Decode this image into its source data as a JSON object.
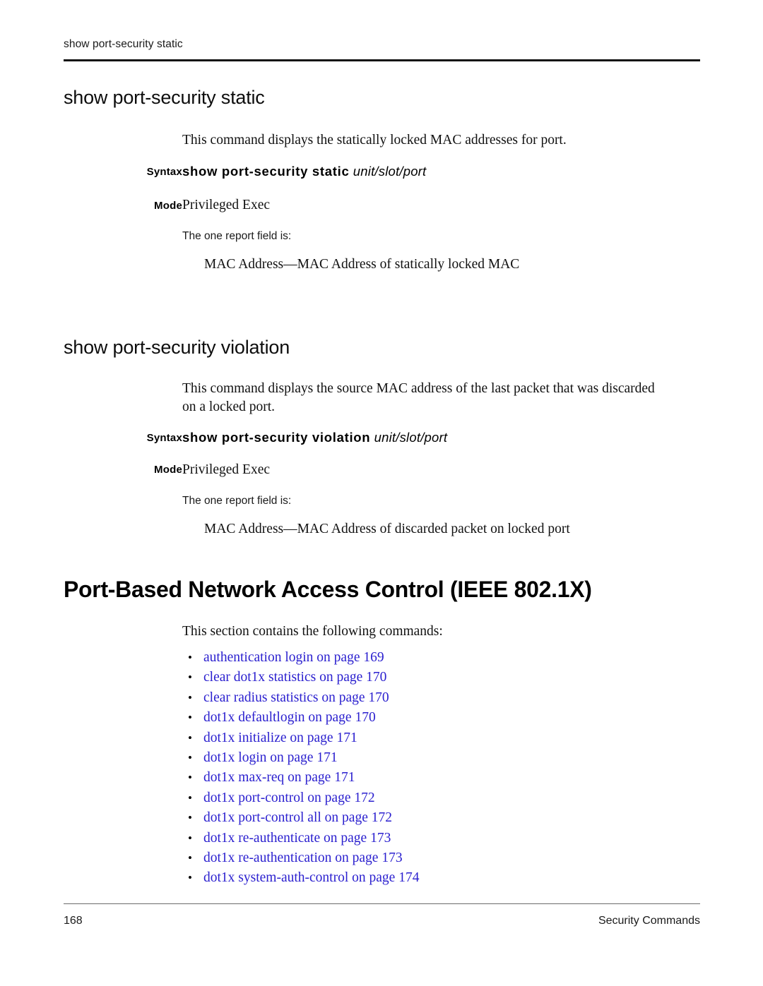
{
  "running_header": "show port-security static",
  "sections": [
    {
      "heading": "show port-security static",
      "description": "This command displays the statically locked MAC addresses for port.",
      "syntax_label": "Syntax",
      "syntax_command": "show port-security static",
      "syntax_argument": "unit/slot/port",
      "mode_label": "Mode",
      "mode_value": "Privileged Exec",
      "report_note": "The one report field is:",
      "report_field": "MAC Address—MAC Address of statically locked MAC"
    },
    {
      "heading": "show port-security violation",
      "description": "This command displays the source MAC address of the last packet that was discarded on a locked port.",
      "syntax_label": "Syntax",
      "syntax_command": "show port-security violation",
      "syntax_argument": "unit/slot/port",
      "mode_label": "Mode",
      "mode_value": "Privileged Exec",
      "report_note": "The one report field is:",
      "report_field": "MAC Address—MAC Address of discarded packet on locked port"
    }
  ],
  "major_section": {
    "heading": "Port-Based Network Access Control (IEEE 802.1X)",
    "intro": "This section contains the following commands:",
    "bullet": "•",
    "links": [
      "authentication login on page 169",
      "clear dot1x statistics on page 170",
      "clear radius statistics on page 170",
      "dot1x defaultlogin on page 170",
      "dot1x initialize on page 171",
      "dot1x login on page 171",
      "dot1x max-req on page 171",
      "dot1x port-control on page 172",
      "dot1x port-control all on page 172",
      "dot1x re-authenticate on page 173",
      "dot1x re-authentication on page 173",
      "dot1x system-auth-control on page 174"
    ]
  },
  "footer": {
    "page_number": "168",
    "title": "Security Commands"
  },
  "colors": {
    "link": "#2b20cf",
    "text": "#111111",
    "rule_dark": "#111111",
    "rule_light": "#6b6b6b"
  }
}
